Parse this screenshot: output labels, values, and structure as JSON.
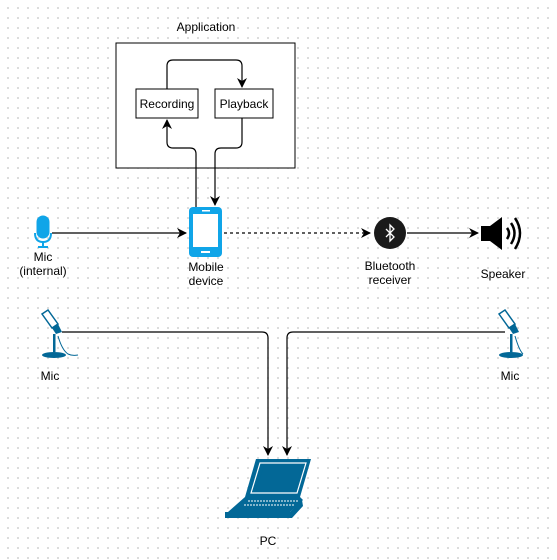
{
  "application": {
    "label": "Application",
    "recording": "Recording",
    "playback": "Playback"
  },
  "nodes": {
    "mic_internal": {
      "line1": "Mic",
      "line2": "(internal)"
    },
    "mobile": {
      "line1": "Mobile",
      "line2": "device"
    },
    "bluetooth": {
      "line1": "Bluetooth",
      "line2": "receiver"
    },
    "speaker": {
      "label": "Speaker"
    },
    "mic_left": {
      "label": "Mic"
    },
    "mic_right": {
      "label": "Mic"
    },
    "pc": {
      "label": "PC"
    }
  },
  "colors": {
    "mobile": "#10a5e8",
    "cisco": "#036897",
    "edge": "#000000"
  }
}
